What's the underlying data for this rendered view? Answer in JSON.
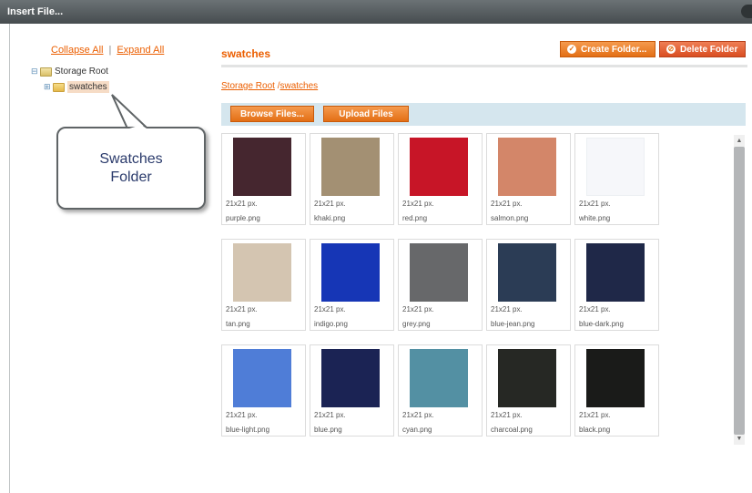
{
  "window": {
    "title": "Insert File..."
  },
  "tree": {
    "collapse_all": "Collapse All",
    "separator": "|",
    "expand_all": "Expand All",
    "root": "Storage Root",
    "child": "swatches"
  },
  "callout": {
    "line1": "Swatches",
    "line2": "Folder"
  },
  "header": {
    "folder_title": "swatches",
    "create_folder": "Create Folder...",
    "delete_folder": "Delete Folder"
  },
  "breadcrumb": {
    "root": "Storage Root",
    "sep": " /",
    "current": "swatches"
  },
  "toolbar": {
    "browse": "Browse Files...",
    "upload": "Upload Files"
  },
  "files": [
    {
      "dim": "21x21 px.",
      "name": "purple.png",
      "color": "#45262f"
    },
    {
      "dim": "21x21 px.",
      "name": "khaki.png",
      "color": "#a39073"
    },
    {
      "dim": "21x21 px.",
      "name": "red.png",
      "color": "#c71527"
    },
    {
      "dim": "21x21 px.",
      "name": "salmon.png",
      "color": "#d38669"
    },
    {
      "dim": "21x21 px.",
      "name": "white.png",
      "color": "#f6f7fa"
    },
    {
      "dim": "21x21 px.",
      "name": "tan.png",
      "color": "#d4c5b1"
    },
    {
      "dim": "21x21 px.",
      "name": "indigo.png",
      "color": "#1636b6"
    },
    {
      "dim": "21x21 px.",
      "name": "grey.png",
      "color": "#67686a"
    },
    {
      "dim": "21x21 px.",
      "name": "blue-jean.png",
      "color": "#2b3c55"
    },
    {
      "dim": "21x21 px.",
      "name": "blue-dark.png",
      "color": "#1f2848"
    },
    {
      "dim": "21x21 px.",
      "name": "blue-light.png",
      "color": "#4f7dd7"
    },
    {
      "dim": "21x21 px.",
      "name": "blue.png",
      "color": "#1b2354"
    },
    {
      "dim": "21x21 px.",
      "name": "cyan.png",
      "color": "#5390a3"
    },
    {
      "dim": "21x21 px.",
      "name": "charcoal.png",
      "color": "#262824"
    },
    {
      "dim": "21x21 px.",
      "name": "black.png",
      "color": "#1a1b19"
    }
  ]
}
